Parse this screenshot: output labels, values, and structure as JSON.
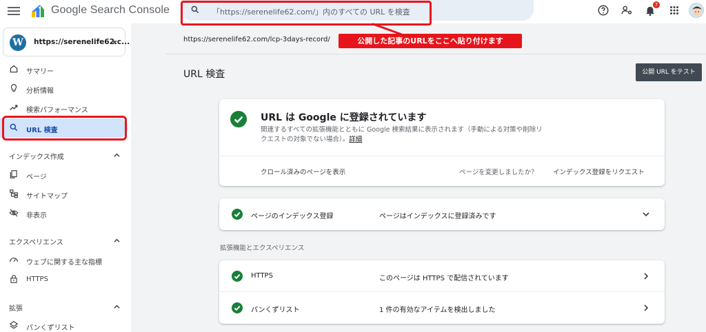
{
  "header": {
    "brand": "Google Search Console",
    "search_placeholder": "「https://serenelife62.com/」内のすべての URL を検査",
    "notification_count": "7"
  },
  "sidebar": {
    "property_url": "https://serenelife62.c...",
    "top_items": [
      {
        "label": "サマリー",
        "icon": "home-icon"
      },
      {
        "label": "分析情報",
        "icon": "lightbulb-icon"
      },
      {
        "label": "検索パフォーマンス",
        "icon": "trending-up-icon"
      },
      {
        "label": "URL 検査",
        "icon": "search-icon",
        "active": true
      }
    ],
    "sections": [
      {
        "title": "インデックス作成",
        "items": [
          {
            "label": "ページ",
            "icon": "pages-icon"
          },
          {
            "label": "サイトマップ",
            "icon": "sitemap-icon"
          },
          {
            "label": "非表示",
            "icon": "eye-off-icon"
          }
        ]
      },
      {
        "title": "エクスペリエンス",
        "items": [
          {
            "label": "ウェブに関する主な指標",
            "icon": "speed-icon"
          },
          {
            "label": "HTTPS",
            "icon": "lock-icon"
          }
        ]
      },
      {
        "title": "拡張",
        "items": [
          {
            "label": "パンくずリスト",
            "icon": "layers-icon"
          }
        ]
      }
    ]
  },
  "main": {
    "inspected_url": "https://serenelife62.com/lcp-3days-record/",
    "annotation": "公開した記事のURLをここへ貼り付けます",
    "title": "URL 検査",
    "test_button": "公開 URL をテスト",
    "status": {
      "title": "URL は Google に登録されています",
      "description": "関連するすべての拡張機能とともに Google 検索結果に表示されます（手動による対策や削除リクエストの対象でない場合）。",
      "details_link": "詳細",
      "crawl_link": "クロール済みのページを表示",
      "changed_text": "ページを変更しましたか？",
      "request_index": "インデックス登録をリクエスト"
    },
    "index_row": {
      "label": "ページのインデックス登録",
      "value": "ページはインデックスに登録済みです"
    },
    "enhancements_heading": "拡張機能とエクスペリエンス",
    "enhancements": [
      {
        "label": "HTTPS",
        "value": "このページは HTTPS で配信されています"
      },
      {
        "label": "パンくずリスト",
        "value": "1 件の有効なアイテムを検出しました"
      }
    ]
  },
  "colors": {
    "accent": "#188038",
    "highlight": "#e8141b",
    "active_bg": "#d2e3fc"
  }
}
